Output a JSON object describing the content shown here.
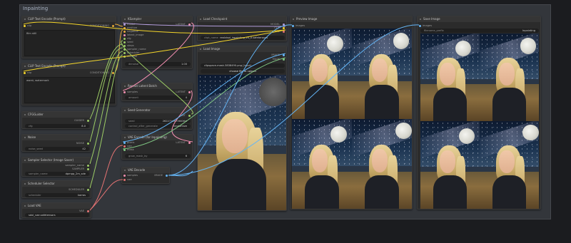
{
  "group": {
    "title": "Inpainting"
  },
  "nodes": {
    "clip_pos": {
      "title": "CLIP Text Encode (Prompt)",
      "in_clip": "clip",
      "out": "CONDITIONING",
      "text": "film still"
    },
    "clip_neg": {
      "title": "CLIP Text Encode (Prompt)",
      "in_clip": "clip",
      "out": "CONDITIONING",
      "text": "worst, watermark"
    },
    "cfg_guide": {
      "title": "CFGGuider",
      "out": "GUIDER",
      "w_label": "cfg",
      "w_value": "8.0"
    },
    "noise": {
      "title": "Noise",
      "out": "NOISE",
      "w_label": "noise_seed",
      "w_value": "42"
    },
    "sampler_select": {
      "title": "Sampler Selector (Image Saver)",
      "out1": "sampler_name",
      "out2": "SAMPLER",
      "w_label": "sampler_name",
      "w_value": "dpmpp_2m_sde"
    },
    "scheduler_select": {
      "title": "Scheduler Selector",
      "out": "SCHEDULER",
      "w_label": "scheduler",
      "w_value": "karras"
    },
    "load_vae": {
      "title": "Load VAE",
      "out": "VAE",
      "w_value": "sdxl_vae.safetensors"
    },
    "ksampler": {
      "title": "KSampler",
      "inputs": [
        "model",
        "positive",
        "negative",
        "latent_image",
        "cfg",
        "seed",
        "steps",
        "sampler_name",
        "scheduler",
        "denoise"
      ],
      "out": "LATENT",
      "w_label": "denoise",
      "w_value": "1.00"
    },
    "repeat_latent": {
      "title": "Repeat Latent Batch",
      "in": "samples",
      "out": "LATENT",
      "w_label": "amount",
      "w_value": "4"
    },
    "seed_gen": {
      "title": "Seed Generator",
      "out": "INT",
      "w_label": "seed",
      "w_value": "262271067360364",
      "w2_label": "control_after_generate",
      "w2_value": "randomize"
    },
    "vae_encode_inpaint": {
      "title": "VAE Encode (for Inpainting)",
      "inputs": [
        "pixels",
        "vae",
        "mask"
      ],
      "out": "LATENT",
      "w_label": "grow_mask_by",
      "w_value": "6"
    },
    "vae_decode": {
      "title": "VAE Decode",
      "inputs": [
        "samples",
        "vae"
      ],
      "out": "IMAGE"
    },
    "load_checkpoint": {
      "title": "Load Checkpoint",
      "outs": [
        "MODEL",
        "CLIP",
        "VAE"
      ],
      "w_label": "ckpt_name",
      "w_value": "realvisxl_inpainting_v4_0.safetensors"
    },
    "load_image": {
      "title": "Load Image",
      "outs": [
        "IMAGE",
        "MASK"
      ],
      "w_value": "clipspace-mask-3838490.png [input]",
      "button": "choose file to upload"
    },
    "preview_image": {
      "title": "Preview Image",
      "in": "images"
    },
    "save_image": {
      "title": "Save Image",
      "in": "images",
      "w_label": "filename_prefix",
      "w_value": "Inpainting"
    }
  },
  "colors": {
    "clip": "#f5d62a",
    "conditioning": "#e6a93a",
    "model": "#b39ddb",
    "vae": "#e57373",
    "latent": "#f48fb1",
    "image": "#64b5f6",
    "mask": "#81c784",
    "int": "#9ccc65"
  }
}
